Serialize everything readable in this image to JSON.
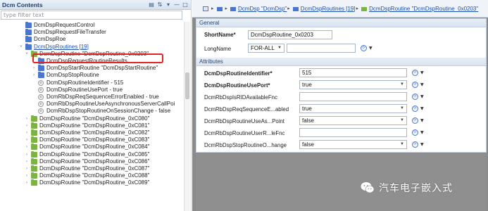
{
  "left_panel": {
    "title": "Dcm Contents",
    "filter_placeholder": "type filter text",
    "tree": [
      {
        "label": "DcmDspRequestControl",
        "icon": "folder-icon",
        "level": 3,
        "twisty": ""
      },
      {
        "label": "DcmDspRequestFileTransfer",
        "icon": "folder-icon",
        "level": 3,
        "twisty": ""
      },
      {
        "label": "DcmDspRoe",
        "icon": "folder-icon",
        "level": 3,
        "twisty": ""
      },
      {
        "label": "DcmDspRoutines [19]",
        "icon": "folder-icon",
        "level": 3,
        "twisty": "v"
      },
      {
        "label": "DcmDspRoutine \"DcmDspRoutine_0x0203\"",
        "icon": "green-folder-icon",
        "level": 4,
        "twisty": "v"
      },
      {
        "label": "DcmDspRequestRoutineResults",
        "icon": "folder-icon",
        "level": 5,
        "twisty": ""
      },
      {
        "label": "DcmDspStartRoutine \"DcmDspStartRoutine\"",
        "icon": "folder-icon",
        "level": 5,
        "twisty": ">"
      },
      {
        "label": "DcmDspStopRoutine",
        "icon": "folder-icon",
        "level": 5,
        "twisty": ">"
      },
      {
        "label": "DcmDspRoutineIdentifier - 515",
        "icon": "parameter-icon",
        "level": 5,
        "twisty": ""
      },
      {
        "label": "DcmDspRoutineUsePort - true",
        "icon": "parameter-icon",
        "level": 5,
        "twisty": ""
      },
      {
        "label": "DcmRbDspReqSequenceErrorEnabled - true",
        "icon": "parameter-icon",
        "level": 5,
        "twisty": ""
      },
      {
        "label": "DcmRbDspRoutineUseAsynchronousServerCallPoi",
        "icon": "parameter-icon",
        "level": 5,
        "twisty": ""
      },
      {
        "label": "DcmRbDspStopRoutineOnSessionChange - false",
        "icon": "parameter-icon",
        "level": 5,
        "twisty": ""
      },
      {
        "label": "DcmDspRoutine \"DcmDspRoutine_0xC080\"",
        "icon": "green-folder-icon",
        "level": 4,
        "twisty": ">"
      },
      {
        "label": "DcmDspRoutine \"DcmDspRoutine_0xC081\"",
        "icon": "green-folder-icon",
        "level": 4,
        "twisty": ">"
      },
      {
        "label": "DcmDspRoutine \"DcmDspRoutine_0xC082\"",
        "icon": "green-folder-icon",
        "level": 4,
        "twisty": ">"
      },
      {
        "label": "DcmDspRoutine \"DcmDspRoutine_0xC083\"",
        "icon": "green-folder-icon",
        "level": 4,
        "twisty": ">"
      },
      {
        "label": "DcmDspRoutine \"DcmDspRoutine_0xC084\"",
        "icon": "green-folder-icon",
        "level": 4,
        "twisty": ">"
      },
      {
        "label": "DcmDspRoutine \"DcmDspRoutine_0xC085\"",
        "icon": "green-folder-icon",
        "level": 4,
        "twisty": ">"
      },
      {
        "label": "DcmDspRoutine \"DcmDspRoutine_0xC086\"",
        "icon": "green-folder-icon",
        "level": 4,
        "twisty": ">"
      },
      {
        "label": "DcmDspRoutine \"DcmDspRoutine_0xC087\"",
        "icon": "green-folder-icon",
        "level": 4,
        "twisty": ">"
      },
      {
        "label": "DcmDspRoutine \"DcmDspRoutine_0xC088\"",
        "icon": "green-folder-icon",
        "level": 4,
        "twisty": ">"
      },
      {
        "label": "DcmDspRoutine \"DcmDspRoutine_0xC089\"",
        "icon": "green-folder-icon",
        "level": 4,
        "twisty": ">"
      }
    ],
    "selected_label": "DcmDspRoutine \"DcmDspRoutine_0x0203\""
  },
  "breadcrumb": {
    "items": [
      "DcmDsp \"DcmDsp\"",
      "DcmDspRoutines [19]",
      "DcmDspRoutine \"DcmDspRoutine_0x0203\""
    ]
  },
  "general": {
    "title": "General",
    "short_name_label": "ShortName*",
    "short_name_value": "DcmDspRoutine_0x0203",
    "long_name_label": "LongName",
    "long_name_lang": "FOR-ALL",
    "long_name_value": ""
  },
  "attributes": {
    "title": "Attributes",
    "rows": [
      {
        "label": "DcmDspRoutineIdentifier*",
        "value": "515",
        "kind": "text",
        "bold": true
      },
      {
        "label": "DcmDspRoutineUsePort*",
        "value": "true",
        "kind": "select",
        "bold": true
      },
      {
        "label": "DcmRbDspIsRIDAvailableFnc",
        "value": "",
        "kind": "text",
        "bold": false
      },
      {
        "label": "DcmRbDspReqSequenceE...abled",
        "value": "true",
        "kind": "select",
        "bold": false
      },
      {
        "label": "DcmRbDspRoutineUseAs...Point",
        "value": "false",
        "kind": "select",
        "bold": false
      },
      {
        "label": "DcmRbDspRoutineUserR...leFnc",
        "value": "",
        "kind": "text",
        "bold": false
      },
      {
        "label": "DcmRbDspStopRoutineO...hange",
        "value": "false",
        "kind": "select",
        "bold": false
      }
    ]
  },
  "watermark": {
    "text": "汽车电子嵌入式"
  },
  "colors": {
    "accent": "#1a4fb0",
    "highlight_box": "#e02424",
    "green_folder": "#7cb342",
    "blue_folder": "#4a76d0"
  }
}
